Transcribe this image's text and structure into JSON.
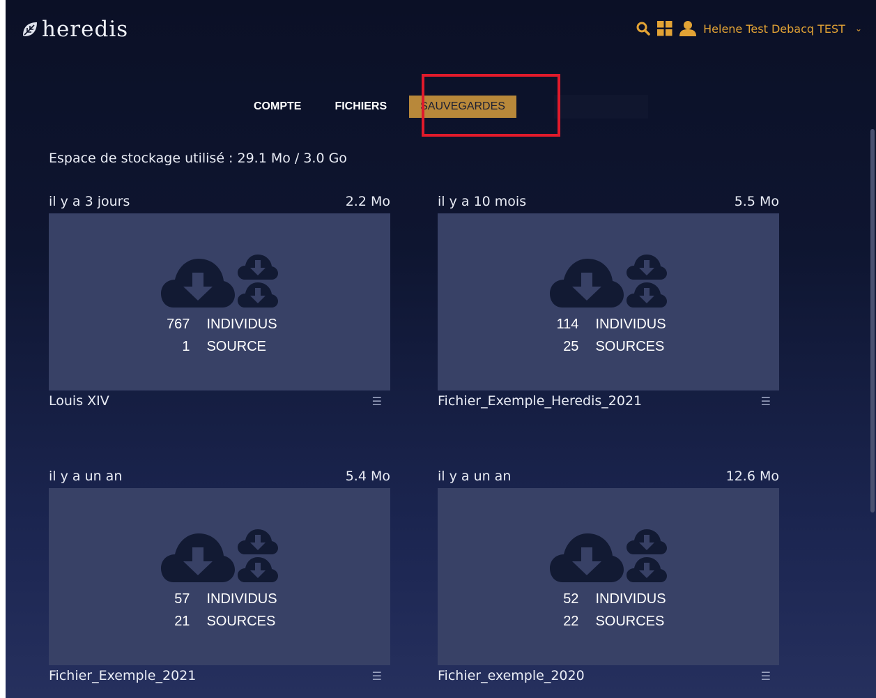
{
  "app": {
    "logo_text": "heredis"
  },
  "header": {
    "user_name": "Helene Test Debacq TEST",
    "accent_color": "#e3a335"
  },
  "tabs": [
    {
      "label": "COMPTE",
      "active": false
    },
    {
      "label": "FICHIERS",
      "active": false
    },
    {
      "label": "SAUVEGARDES",
      "active": true
    }
  ],
  "storage": {
    "text": "Espace de stockage utilisé : 29.1 Mo / 3.0 Go"
  },
  "backups": [
    {
      "age": "il y a 3 jours",
      "size": "2.2 Mo",
      "individus": "767",
      "individus_label": "INDIVIDUS",
      "sources": "1",
      "sources_label": "SOURCE",
      "name": "Louis XIV"
    },
    {
      "age": "il y a 10 mois",
      "size": "5.5 Mo",
      "individus": "114",
      "individus_label": "INDIVIDUS",
      "sources": "25",
      "sources_label": "SOURCES",
      "name": "Fichier_Exemple_Heredis_2021"
    },
    {
      "age": "il y a un an",
      "size": "5.4 Mo",
      "individus": "57",
      "individus_label": "INDIVIDUS",
      "sources": "21",
      "sources_label": "SOURCES",
      "name": "Fichier_Exemple_2021"
    },
    {
      "age": "il y a un an",
      "size": "12.6 Mo",
      "individus": "52",
      "individus_label": "INDIVIDUS",
      "sources": "22",
      "sources_label": "SOURCES",
      "name": "Fichier_exemple_2020"
    }
  ]
}
